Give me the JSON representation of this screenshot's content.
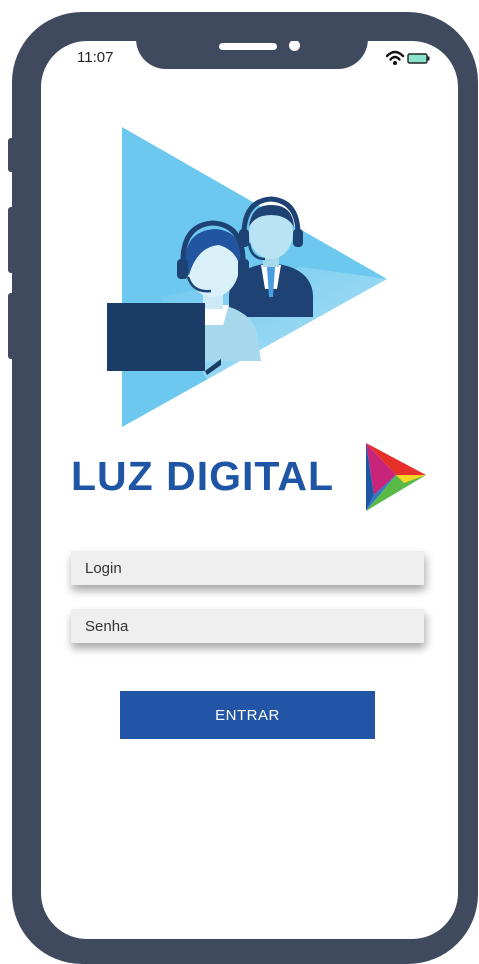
{
  "status_bar": {
    "time": "11:07",
    "icons": [
      "wifi-icon",
      "battery-icon"
    ]
  },
  "brand": {
    "name": "LUZ DIGITAL",
    "primary_color": "#1f55a5",
    "accent_color": "#6cc8ef"
  },
  "login_form": {
    "login_placeholder": "Login",
    "password_placeholder": "Senha",
    "submit_label": "ENTRAR"
  },
  "device": {
    "frame_color": "#3f4a5e"
  }
}
